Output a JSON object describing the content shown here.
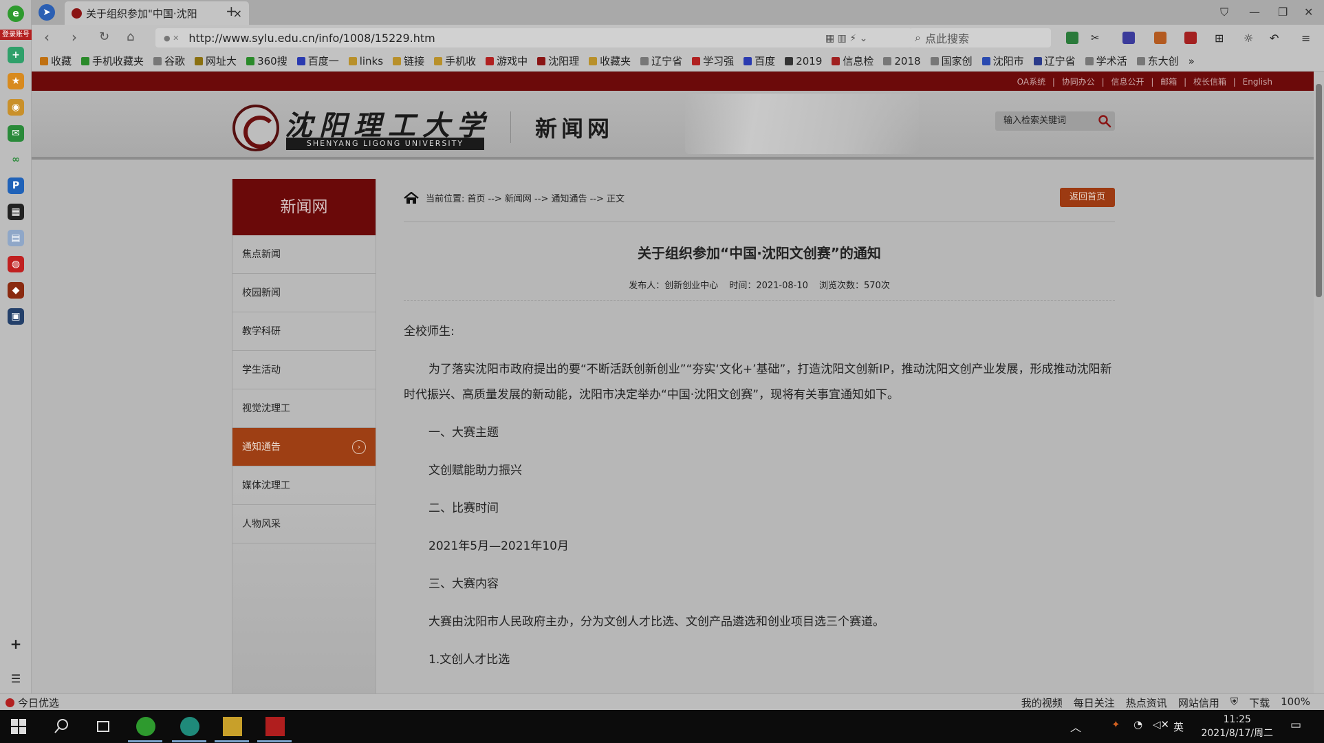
{
  "browser": {
    "login_badge": "登录账号",
    "tab_title": "关于组织参加\"中国·沈阳",
    "tab_close": "×",
    "new_tab": "+",
    "url": "http://www.sylu.edu.cn/info/1008/15229.htm",
    "search_placeholder": "点此搜索",
    "bookmarks": [
      "收藏",
      "手机收藏夹",
      "谷歌",
      "网址大",
      "360搜",
      "百度一",
      "links",
      "链接",
      "手机收",
      "游戏中",
      "沈阳理",
      "收藏夹",
      "辽宁省",
      "学习强",
      "百度",
      "2019",
      "信息检",
      "2018",
      "国家创",
      "沈阳市",
      "辽宁省",
      "学术活",
      "东大创"
    ],
    "bookmarks_more": "»"
  },
  "site": {
    "top_links": [
      "OA系统",
      "协同办公",
      "信息公开",
      "邮箱",
      "校长信箱",
      "English"
    ],
    "top_link_sep": "|",
    "logo_cn": "沈阳理工大学",
    "logo_en": "SHENYANG LIGONG UNIVERSITY",
    "site_title": "新闻网",
    "search_placeholder": "输入检索关键词"
  },
  "sidebar": {
    "heading": "新闻网",
    "items": [
      {
        "label": "焦点新闻"
      },
      {
        "label": "校园新闻"
      },
      {
        "label": "教学科研"
      },
      {
        "label": "学生活动"
      },
      {
        "label": "视觉沈理工"
      },
      {
        "label": "通知通告",
        "active": true
      },
      {
        "label": "媒体沈理工"
      },
      {
        "label": "人物风采"
      }
    ]
  },
  "breadcrumb": {
    "prefix": "当前位置:",
    "path": "首页 --> 新闻网 --> 通知通告 --> 正文"
  },
  "back_button": "返回首页",
  "article": {
    "title": "关于组织参加“中国·沈阳文创赛”的通知",
    "publisher": "发布人：创新创业中心",
    "time": "时间：2021-08-10",
    "views": "浏览次数：570次",
    "salutation": "全校师生:",
    "intro": "为了落实沈阳市政府提出的要“不断活跃创新创业”“夯实‘文化+’基础”，打造沈阳文创新IP，推动沈阳文创产业发展，形成推动沈阳新时代振兴、高质量发展的新动能，沈阳市决定举办“中国·沈阳文创赛”，现将有关事宜通知如下。",
    "h1": "一、大赛主题",
    "p1": "文创赋能助力振兴",
    "h2": "二、比赛时间",
    "p2": "2021年5月—2021年10月",
    "h3": "三、大赛内容",
    "p3": "大赛由沈阳市人民政府主办，分为文创人才比选、文创产品遴选和创业项目选三个赛道。",
    "h4": "1.文创人才比选"
  },
  "statusbar": {
    "left": "今日优选",
    "right": [
      "我的视频",
      "每日关注",
      "热点资讯",
      "网站信用",
      "下载",
      "100%"
    ]
  },
  "taskbar": {
    "ime": "英",
    "time": "11:25",
    "date": "2021/8/17/周二"
  }
}
